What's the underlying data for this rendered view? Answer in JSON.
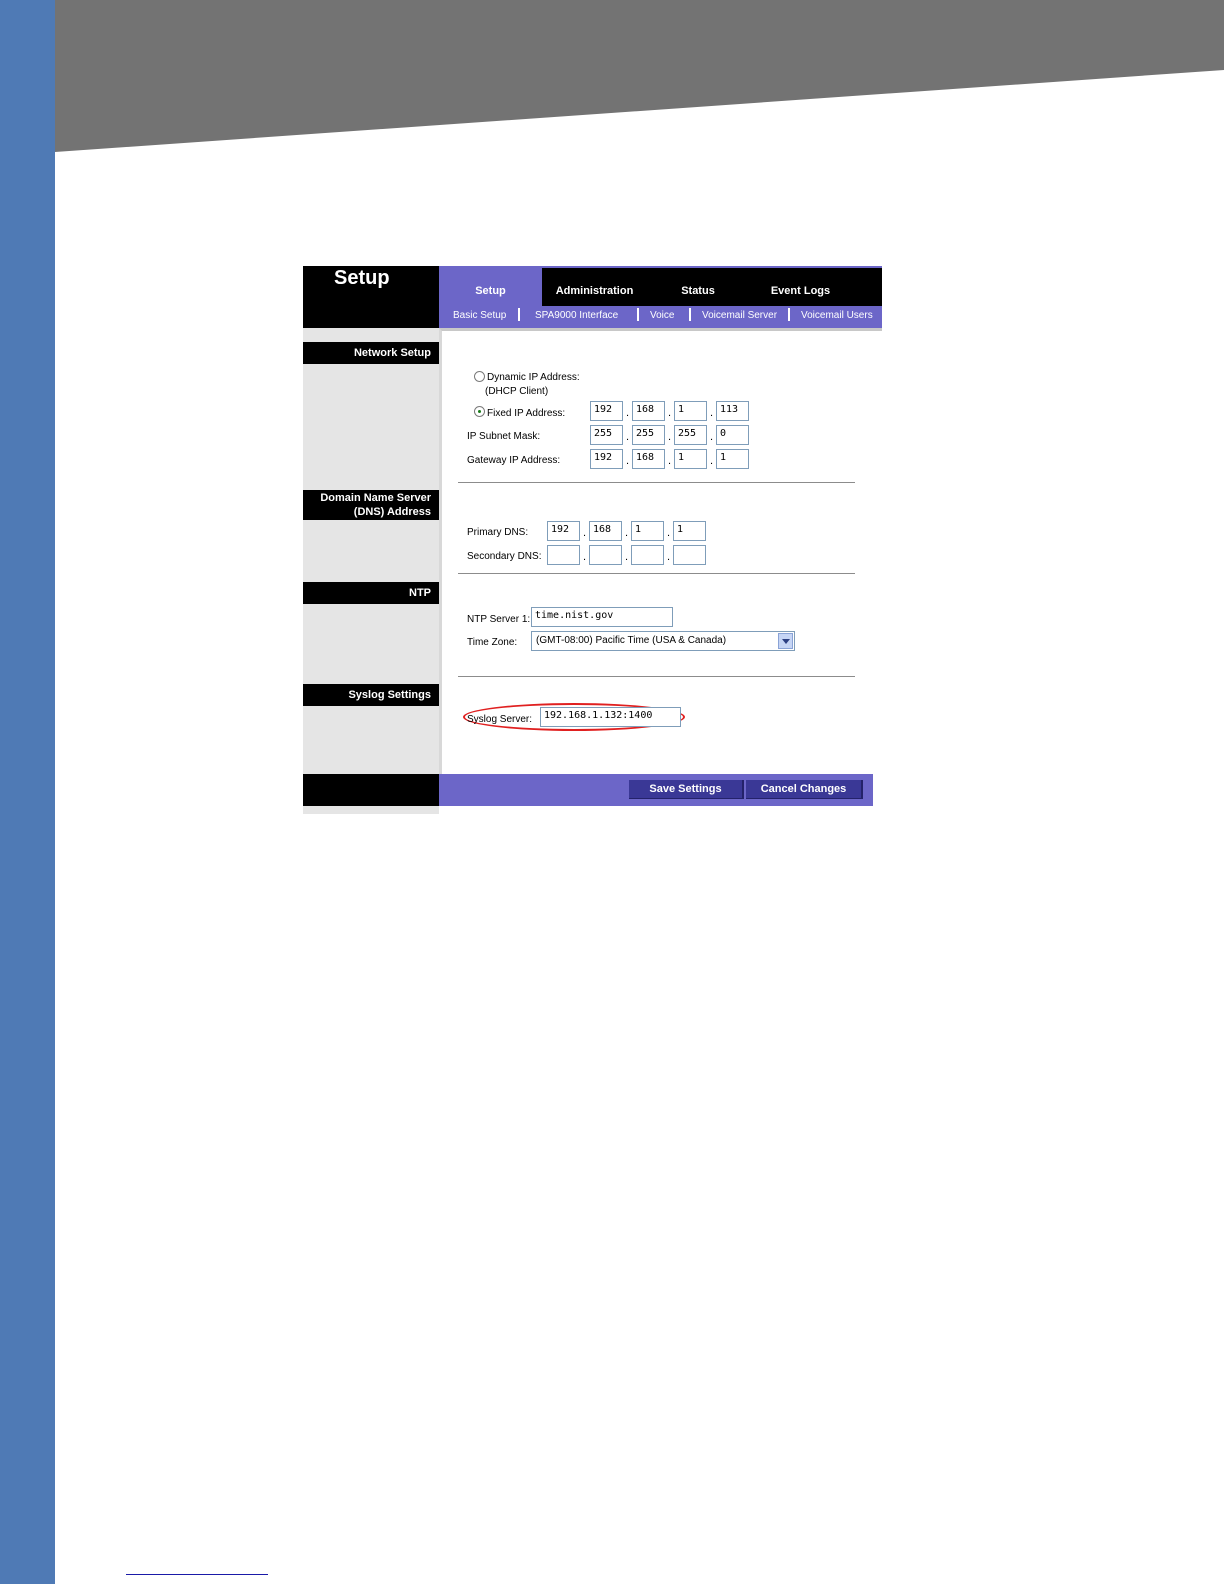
{
  "brand_title": "Setup",
  "tabs": [
    "Setup",
    "Administration",
    "Status",
    "Event Logs"
  ],
  "subnav": [
    "Basic Setup",
    "SPA9000 Interface",
    "Voice",
    "Voicemail Server",
    "Voicemail Users"
  ],
  "sections": {
    "network": "Network Setup",
    "dns_line1": "Domain Name Server",
    "dns_line2": "(DNS) Address",
    "ntp": "NTP",
    "syslog": "Syslog Settings"
  },
  "network": {
    "dynamic_label": "Dynamic IP Address:",
    "dynamic_sub": "(DHCP Client)",
    "fixed_label": "Fixed IP Address:",
    "subnet_label": "IP Subnet Mask:",
    "gateway_label": "Gateway IP Address:",
    "fixed_ip": [
      "192",
      "168",
      "1",
      "113"
    ],
    "subnet": [
      "255",
      "255",
      "255",
      "0"
    ],
    "gateway": [
      "192",
      "168",
      "1",
      "1"
    ],
    "selected": "fixed"
  },
  "dns": {
    "primary_label": "Primary DNS:",
    "secondary_label": "Secondary DNS:",
    "primary": [
      "192",
      "168",
      "1",
      "1"
    ],
    "secondary": [
      "",
      "",
      "",
      ""
    ]
  },
  "ntp": {
    "server_label": "NTP Server 1:",
    "server_value": "time.nist.gov",
    "tz_label": "Time Zone:",
    "tz_value": "(GMT-08:00) Pacific Time (USA & Canada)"
  },
  "syslog": {
    "label": "Syslog Server:",
    "value": "192.168.1.132:1400"
  },
  "buttons": {
    "save": "Save Settings",
    "cancel": "Cancel Changes"
  },
  "colors": {
    "accent": "#6c66c8",
    "sidebar": "#4f7ab5",
    "highlight": "#e02020"
  }
}
